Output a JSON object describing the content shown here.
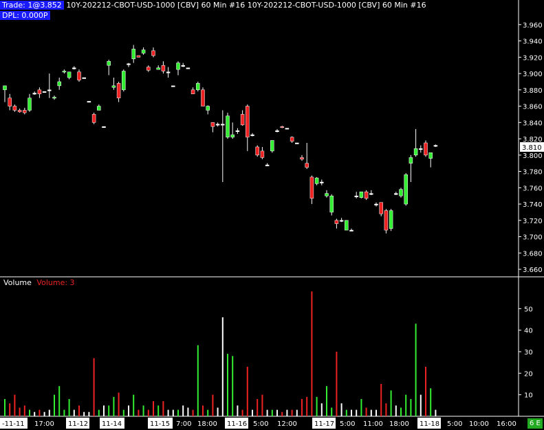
{
  "header": {
    "trade_badge": "Trade: 1@3.852",
    "symbol_title": "10Y-202212-CBOT-USD-1000 [CBV]  60 Min   #16 10Y-202212-CBOT-USD-1000 [CBV] 60 Min  #16",
    "dpl_badge": "DPL: 0.000P"
  },
  "volume_panel": {
    "label": "Volume",
    "value_label": "Volume: 3"
  },
  "corner_badge": "6 E",
  "colors": {
    "background": "#000000",
    "up": "#33ee33",
    "down": "#ee2222",
    "neutral": "#ffffff",
    "price_box": "#ffffff"
  },
  "chart_data": {
    "type": "candlestick",
    "price_axis": {
      "ylim": [
        3.655,
        3.975
      ],
      "ticks": [
        "3.960",
        "3.940",
        "3.920",
        "3.900",
        "3.880",
        "3.860",
        "3.840",
        "3.820",
        "3.800",
        "3.780",
        "3.760",
        "3.740",
        "3.720",
        "3.700",
        "3.680",
        "3.660"
      ],
      "current_price": "3.810"
    },
    "volume_axis": {
      "ylim": [
        0,
        60
      ],
      "ticks": [
        "50",
        "40",
        "30",
        "20",
        "10"
      ]
    },
    "time_axis": {
      "date_labels": [
        "-11-11",
        "11-12",
        "11-14",
        "11-15",
        "11-16",
        "11-17",
        "11-18"
      ],
      "time_labels": [
        "17:00",
        "7:00",
        "18:00",
        "5:00",
        "12:00",
        "5:00",
        "11:00",
        "18:00",
        "5:00",
        "10:00",
        "16:00"
      ]
    },
    "candles": [
      {
        "o": 3.88,
        "h": 3.885,
        "l": 3.865,
        "c": 3.885,
        "v": 8
      },
      {
        "o": 3.87,
        "h": 3.875,
        "l": 3.855,
        "c": 3.86,
        "v": 6
      },
      {
        "o": 3.86,
        "h": 3.862,
        "l": 3.853,
        "c": 3.855,
        "v": 10
      },
      {
        "o": 3.855,
        "h": 3.857,
        "l": 3.852,
        "c": 3.853,
        "v": 4
      },
      {
        "o": 3.855,
        "h": 3.858,
        "l": 3.85,
        "c": 3.852,
        "v": 5
      },
      {
        "o": 3.855,
        "h": 3.875,
        "l": 3.853,
        "c": 3.87,
        "v": 3
      },
      {
        "o": 3.876,
        "h": 3.878,
        "l": 3.874,
        "c": 3.876,
        "v": 2
      },
      {
        "o": 3.88,
        "h": 3.883,
        "l": 3.87,
        "c": 3.875,
        "v": 3
      },
      {
        "o": 3.878,
        "h": 3.878,
        "l": 3.878,
        "c": 3.878,
        "v": 2
      },
      {
        "o": 3.88,
        "h": 3.9,
        "l": 3.87,
        "c": 3.88,
        "v": 3
      },
      {
        "o": 3.87,
        "h": 3.873,
        "l": 3.868,
        "c": 3.871,
        "v": 10
      },
      {
        "o": 3.885,
        "h": 3.895,
        "l": 3.88,
        "c": 3.89,
        "v": 14
      },
      {
        "o": 3.902,
        "h": 3.905,
        "l": 3.9,
        "c": 3.903,
        "v": 3
      },
      {
        "o": 3.895,
        "h": 3.902,
        "l": 3.893,
        "c": 3.902,
        "v": 8
      },
      {
        "o": 3.907,
        "h": 3.909,
        "l": 3.905,
        "c": 3.907,
        "v": 3
      },
      {
        "o": 3.902,
        "h": 3.905,
        "l": 3.89,
        "c": 3.892,
        "v": 5
      },
      {
        "o": 3.895,
        "h": 3.895,
        "l": 3.895,
        "c": 3.895,
        "v": 2
      },
      {
        "o": 3.866,
        "h": 3.866,
        "l": 3.866,
        "c": 3.866,
        "v": 2
      },
      {
        "o": 3.85,
        "h": 3.852,
        "l": 3.838,
        "c": 3.84,
        "v": 27
      },
      {
        "o": 3.855,
        "h": 3.862,
        "l": 3.855,
        "c": 3.86,
        "v": 3
      },
      {
        "o": 3.835,
        "h": 3.835,
        "l": 3.835,
        "c": 3.835,
        "v": 5
      },
      {
        "o": 3.91,
        "h": 3.917,
        "l": 3.898,
        "c": 3.915,
        "v": 5
      },
      {
        "o": 3.883,
        "h": 3.895,
        "l": 3.88,
        "c": 3.885,
        "v": 9
      },
      {
        "o": 3.888,
        "h": 3.89,
        "l": 3.865,
        "c": 3.87,
        "v": 11
      },
      {
        "o": 3.88,
        "h": 3.905,
        "l": 3.878,
        "c": 3.903,
        "v": 3
      },
      {
        "o": 3.912,
        "h": 3.913,
        "l": 3.908,
        "c": 3.912,
        "v": 5
      },
      {
        "o": 3.918,
        "h": 3.935,
        "l": 3.913,
        "c": 3.93,
        "v": 10
      },
      {
        "o": 3.922,
        "h": 3.922,
        "l": 3.92,
        "c": 3.92,
        "v": 3
      },
      {
        "o": 3.925,
        "h": 3.932,
        "l": 3.923,
        "c": 3.929,
        "v": 5
      },
      {
        "o": 3.908,
        "h": 3.91,
        "l": 3.902,
        "c": 3.904,
        "v": 3
      },
      {
        "o": 3.928,
        "h": 3.932,
        "l": 3.92,
        "c": 3.922,
        "v": 7
      },
      {
        "o": 3.905,
        "h": 3.91,
        "l": 3.905,
        "c": 3.907,
        "v": 5
      },
      {
        "o": 3.91,
        "h": 3.915,
        "l": 3.9,
        "c": 3.903,
        "v": 7
      },
      {
        "o": 3.902,
        "h": 3.908,
        "l": 3.895,
        "c": 3.902,
        "v": 3
      },
      {
        "o": 3.885,
        "h": 3.885,
        "l": 3.885,
        "c": 3.885,
        "v": 3
      },
      {
        "o": 3.905,
        "h": 3.915,
        "l": 3.898,
        "c": 3.913,
        "v": 3
      },
      {
        "o": 3.91,
        "h": 3.913,
        "l": 3.908,
        "c": 3.91,
        "v": 5
      },
      {
        "o": 3.907,
        "h": 3.907,
        "l": 3.907,
        "c": 3.907,
        "v": 4
      },
      {
        "o": 3.88,
        "h": 3.883,
        "l": 3.875,
        "c": 3.875,
        "v": 3
      },
      {
        "o": 3.88,
        "h": 3.89,
        "l": 3.878,
        "c": 3.888,
        "v": 33
      },
      {
        "o": 3.88,
        "h": 3.883,
        "l": 3.86,
        "c": 3.86,
        "v": 5
      },
      {
        "o": 3.855,
        "h": 3.861,
        "l": 3.85,
        "c": 3.86,
        "v": 3
      },
      {
        "o": 3.84,
        "h": 3.84,
        "l": 3.828,
        "c": 3.835,
        "v": 10
      },
      {
        "o": 3.838,
        "h": 3.84,
        "l": 3.835,
        "c": 3.838,
        "v": 4
      },
      {
        "o": 3.838,
        "h": 3.855,
        "l": 3.767,
        "c": 3.838,
        "v": 46
      },
      {
        "o": 3.822,
        "h": 3.852,
        "l": 3.82,
        "c": 3.848,
        "v": 29
      },
      {
        "o": 3.822,
        "h": 3.84,
        "l": 3.82,
        "c": 3.825,
        "v": 28
      },
      {
        "o": 3.83,
        "h": 3.833,
        "l": 3.826,
        "c": 3.83,
        "v": 5
      },
      {
        "o": 3.85,
        "h": 3.855,
        "l": 3.836,
        "c": 3.837,
        "v": 3
      },
      {
        "o": 3.86,
        "h": 3.862,
        "l": 3.805,
        "c": 3.822,
        "v": 23
      },
      {
        "o": 3.825,
        "h": 3.827,
        "l": 3.823,
        "c": 3.825,
        "v": 3
      },
      {
        "o": 3.81,
        "h": 3.812,
        "l": 3.798,
        "c": 3.8,
        "v": 8
      },
      {
        "o": 3.805,
        "h": 3.81,
        "l": 3.795,
        "c": 3.797,
        "v": 10
      },
      {
        "o": 3.788,
        "h": 3.79,
        "l": 3.787,
        "c": 3.788,
        "v": 3
      },
      {
        "o": 3.805,
        "h": 3.818,
        "l": 3.803,
        "c": 3.818,
        "v": 3
      },
      {
        "o": 3.83,
        "h": 3.832,
        "l": 3.828,
        "c": 3.83,
        "v": 3
      },
      {
        "o": 3.835,
        "h": 3.836,
        "l": 3.833,
        "c": 3.834,
        "v": 2
      },
      {
        "o": 3.833,
        "h": 3.833,
        "l": 3.833,
        "c": 3.833,
        "v": 3
      },
      {
        "o": 3.822,
        "h": 3.823,
        "l": 3.815,
        "c": 3.817,
        "v": 3
      },
      {
        "o": 3.815,
        "h": 3.815,
        "l": 3.815,
        "c": 3.815,
        "v": 3
      },
      {
        "o": 3.797,
        "h": 3.8,
        "l": 3.793,
        "c": 3.795,
        "v": 8
      },
      {
        "o": 3.79,
        "h": 3.815,
        "l": 3.783,
        "c": 3.785,
        "v": 9
      },
      {
        "o": 3.773,
        "h": 3.775,
        "l": 3.74,
        "c": 3.747,
        "v": 58
      },
      {
        "o": 3.765,
        "h": 3.773,
        "l": 3.763,
        "c": 3.772,
        "v": 9
      },
      {
        "o": 3.767,
        "h": 3.77,
        "l": 3.763,
        "c": 3.767,
        "v": 6
      },
      {
        "o": 3.75,
        "h": 3.757,
        "l": 3.748,
        "c": 3.753,
        "v": 14
      },
      {
        "o": 3.73,
        "h": 3.752,
        "l": 3.726,
        "c": 3.75,
        "v": 4
      },
      {
        "o": 3.72,
        "h": 3.722,
        "l": 3.71,
        "c": 3.716,
        "v": 30
      },
      {
        "o": 3.72,
        "h": 3.723,
        "l": 3.718,
        "c": 3.72,
        "v": 6
      },
      {
        "o": 3.708,
        "h": 3.72,
        "l": 3.708,
        "c": 3.72,
        "v": 3
      },
      {
        "o": 3.708,
        "h": 3.71,
        "l": 3.707,
        "c": 3.708,
        "v": 3
      },
      {
        "o": 3.75,
        "h": 3.755,
        "l": 3.747,
        "c": 3.75,
        "v": 3
      },
      {
        "o": 3.748,
        "h": 3.755,
        "l": 3.747,
        "c": 3.755,
        "v": 8
      },
      {
        "o": 3.755,
        "h": 3.757,
        "l": 3.745,
        "c": 3.747,
        "v": 4
      },
      {
        "o": 3.753,
        "h": 3.757,
        "l": 3.751,
        "c": 3.753,
        "v": 3
      },
      {
        "o": 3.74,
        "h": 3.742,
        "l": 3.737,
        "c": 3.74,
        "v": 3
      },
      {
        "o": 3.742,
        "h": 3.742,
        "l": 3.725,
        "c": 3.728,
        "v": 15
      },
      {
        "o": 3.732,
        "h": 3.734,
        "l": 3.704,
        "c": 3.708,
        "v": 6
      },
      {
        "o": 3.71,
        "h": 3.734,
        "l": 3.707,
        "c": 3.732,
        "v": 12
      },
      {
        "o": 3.753,
        "h": 3.755,
        "l": 3.751,
        "c": 3.753,
        "v": 5
      },
      {
        "o": 3.75,
        "h": 3.76,
        "l": 3.748,
        "c": 3.758,
        "v": 4
      },
      {
        "o": 3.74,
        "h": 3.778,
        "l": 3.738,
        "c": 3.776,
        "v": 10
      },
      {
        "o": 3.79,
        "h": 3.8,
        "l": 3.767,
        "c": 3.797,
        "v": 8
      },
      {
        "o": 3.8,
        "h": 3.832,
        "l": 3.798,
        "c": 3.808,
        "v": 43
      },
      {
        "o": 3.808,
        "h": 3.812,
        "l": 3.803,
        "c": 3.808,
        "v": 10
      },
      {
        "o": 3.815,
        "h": 3.818,
        "l": 3.798,
        "c": 3.8,
        "v": 23
      },
      {
        "o": 3.796,
        "h": 3.802,
        "l": 3.785,
        "c": 3.803,
        "v": 13
      },
      {
        "o": 3.812,
        "h": 3.813,
        "l": 3.81,
        "c": 3.812,
        "v": 3
      }
    ]
  }
}
